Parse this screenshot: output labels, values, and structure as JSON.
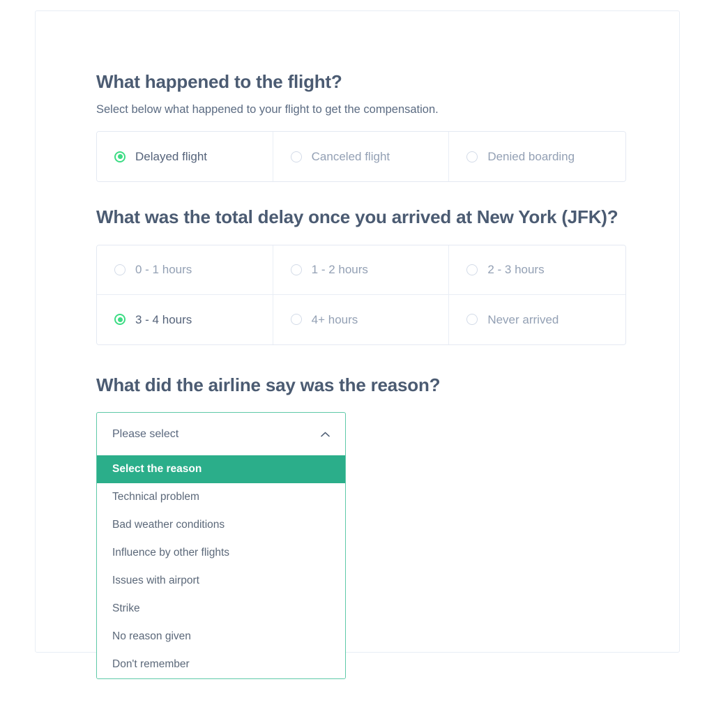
{
  "sections": [
    {
      "id": "flight-event",
      "title": "What happened to the flight?",
      "subtitle": "Select below what happened to your flight to get the compensation.",
      "options": [
        {
          "label": "Delayed flight",
          "selected": true
        },
        {
          "label": "Canceled flight",
          "selected": false
        },
        {
          "label": "Denied boarding",
          "selected": false
        }
      ]
    },
    {
      "id": "total-delay",
      "title": "What was the total delay once you arrived at New York (JFK)?",
      "options": [
        {
          "label": "0 - 1 hours",
          "selected": false
        },
        {
          "label": "1 - 2 hours",
          "selected": false
        },
        {
          "label": "2 - 3 hours",
          "selected": false
        },
        {
          "label": "3 - 4 hours",
          "selected": true
        },
        {
          "label": "4+ hours",
          "selected": false
        },
        {
          "label": "Never arrived",
          "selected": false
        }
      ]
    },
    {
      "id": "airline-reason",
      "title": "What did the airline say was the reason?",
      "dropdown": {
        "value": "Please select",
        "expanded": true,
        "chevron_icon": "chevron-up-icon",
        "options": [
          {
            "label": "Select the reason",
            "highlighted": true
          },
          {
            "label": "Technical problem",
            "highlighted": false
          },
          {
            "label": "Bad weather conditions",
            "highlighted": false
          },
          {
            "label": "Influence by other flights",
            "highlighted": false
          },
          {
            "label": "Issues with airport",
            "highlighted": false
          },
          {
            "label": "Strike",
            "highlighted": false
          },
          {
            "label": "No reason given",
            "highlighted": false
          },
          {
            "label": "Don't remember",
            "highlighted": false
          }
        ]
      }
    }
  ],
  "colors": {
    "heading": "#4b5b72",
    "radio_selected": "#3ddc84",
    "accent_teal": "#2bae8a",
    "dropdown_border": "#5fc9a8",
    "muted_label": "#93a0b4",
    "card_border": "#e8edf5"
  }
}
